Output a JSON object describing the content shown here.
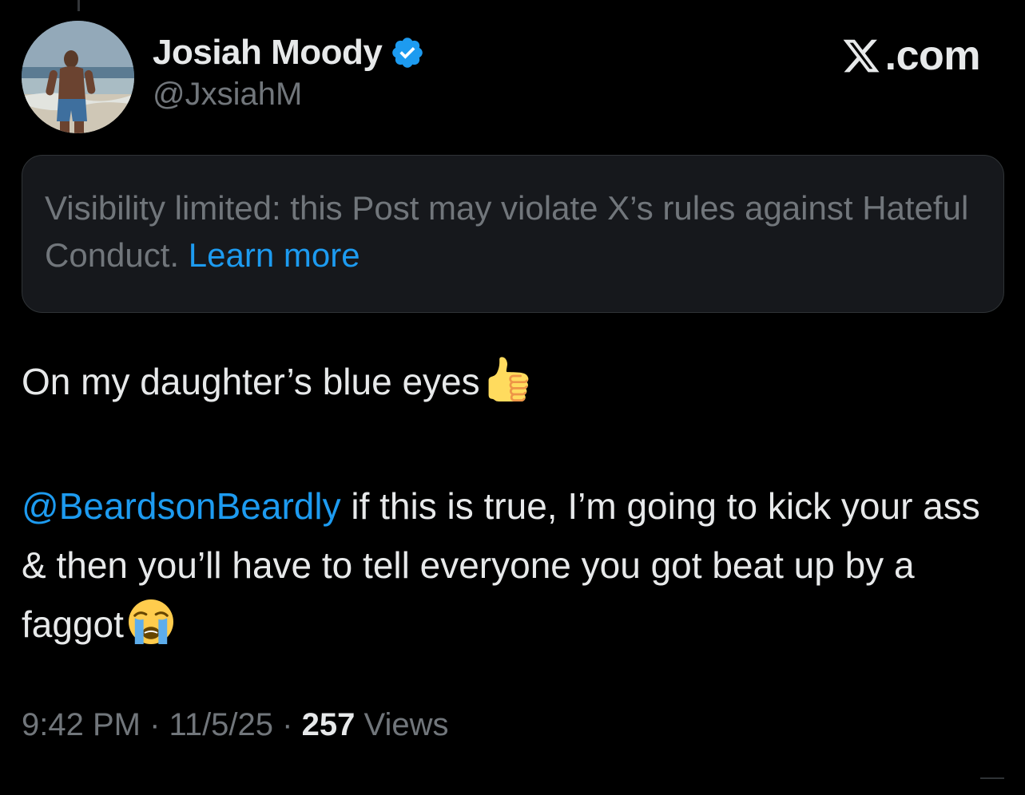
{
  "author": {
    "display_name": "Josiah Moody",
    "handle": "@JxsiahM",
    "verified": true,
    "avatar_icon": "avatar-photo-beach"
  },
  "brand": {
    "label": ".com",
    "icon": "x-logo-icon"
  },
  "notice": {
    "text": "Visibility limited: this Post may violate X’s rules against Hateful Conduct.",
    "link_text": "Learn more"
  },
  "post": {
    "line1": "On my daughter’s blue eyes",
    "line1_emoji": "thumbs-up-icon",
    "mention": "@BeardsonBeardly",
    "line2": "if this is true, I’m going to kick your ass & then you’ll have to tell everyone you got beat up by a faggot",
    "line2_emoji": "loudly-crying-face-icon"
  },
  "meta": {
    "time": "9:42 PM",
    "separator": "·",
    "date": "11/5/25",
    "views_count": "257",
    "views_label": "Views"
  },
  "colors": {
    "background": "#000000",
    "text_primary": "#e7e9ea",
    "text_secondary": "#71767b",
    "accent_link": "#1d9bf0",
    "notice_bg": "#16181c",
    "border": "#2f3336"
  }
}
